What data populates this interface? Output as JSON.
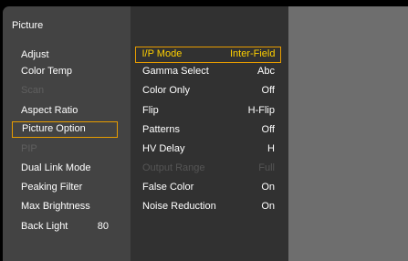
{
  "menu": {
    "title": "Picture",
    "left_items": [
      {
        "label": "Adjust",
        "value": "",
        "state": "normal"
      },
      {
        "label": "Color Temp",
        "value": "",
        "state": "normal"
      },
      {
        "label": "Scan",
        "value": "",
        "state": "disabled"
      },
      {
        "label": "Aspect Ratio",
        "value": "",
        "state": "normal"
      },
      {
        "label": "Picture Option",
        "value": "",
        "state": "selected"
      },
      {
        "label": "PIP",
        "value": "",
        "state": "disabled"
      },
      {
        "label": "Dual Link Mode",
        "value": "",
        "state": "normal"
      },
      {
        "label": "Peaking Filter",
        "value": "",
        "state": "normal"
      },
      {
        "label": "Max Brightness",
        "value": "",
        "state": "normal"
      },
      {
        "label": "Back Light",
        "value": "80",
        "state": "normal"
      }
    ],
    "sub_items": [
      {
        "label": "I/P Mode",
        "value": "Inter-Field",
        "state": "selected"
      },
      {
        "label": "Gamma Select",
        "value": "Abc",
        "state": "normal"
      },
      {
        "label": "Color Only",
        "value": "Off",
        "state": "normal"
      },
      {
        "label": "Flip",
        "value": "H-Flip",
        "state": "normal"
      },
      {
        "label": "Patterns",
        "value": "Off",
        "state": "normal"
      },
      {
        "label": "HV Delay",
        "value": "H",
        "state": "normal"
      },
      {
        "label": "Output Range",
        "value": "Full",
        "state": "disabled"
      },
      {
        "label": "False Color",
        "value": "On",
        "state": "normal"
      },
      {
        "label": "Noise Reduction",
        "value": "On",
        "state": "normal"
      }
    ]
  },
  "colors": {
    "highlight_border": "#e79c00",
    "selected_text": "#ffd000",
    "left_panel_bg": "#434343",
    "sub_panel_bg": "#313131",
    "preview_panel_bg": "#6e6e6e"
  }
}
